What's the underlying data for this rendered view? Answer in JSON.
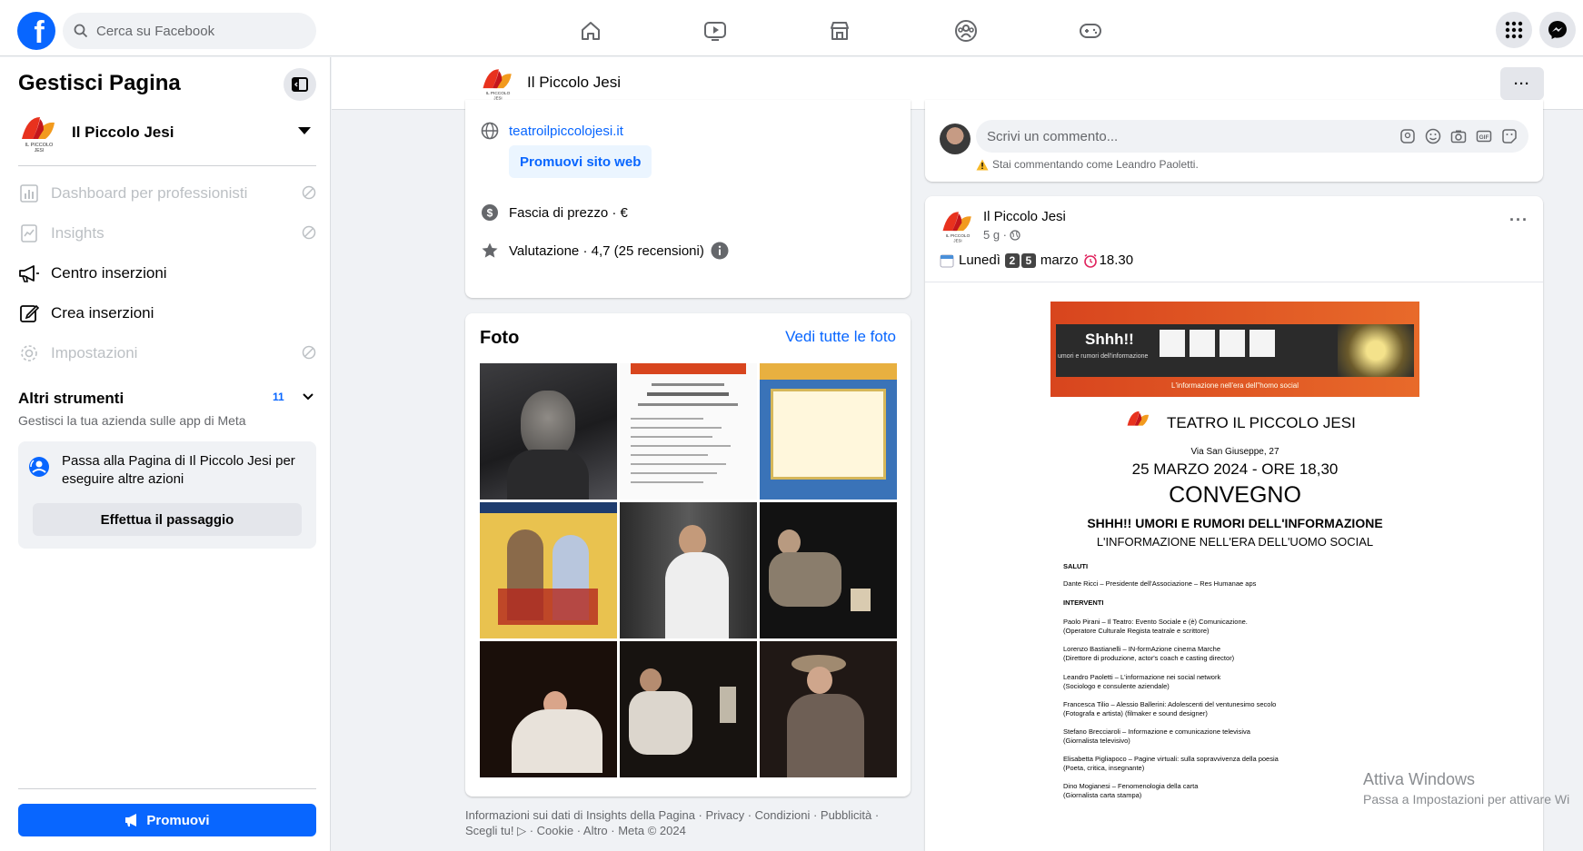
{
  "topbar": {
    "search_placeholder": "Cerca su Facebook",
    "nav_icons": [
      "home-icon",
      "video-icon",
      "marketplace-icon",
      "groups-icon",
      "gaming-icon"
    ],
    "right_icons": [
      "menu-grid-icon",
      "messenger-icon"
    ]
  },
  "sidebar": {
    "title": "Gestisci Pagina",
    "page_name": "Il Piccolo Jesi",
    "logo_text": "IL PICCOLO JESI",
    "items": [
      {
        "label": "Dashboard per professionisti",
        "disabled": true
      },
      {
        "label": "Insights",
        "disabled": true
      },
      {
        "label": "Centro inserzioni",
        "disabled": false
      },
      {
        "label": "Crea inserzioni",
        "disabled": false
      },
      {
        "label": "Impostazioni",
        "disabled": true
      }
    ],
    "tools_title": "Altri strumenti",
    "tools_badge": "11",
    "tools_subtitle": "Gestisci la tua azienda sulle app di Meta",
    "switch_text": "Passa alla Pagina di Il Piccolo Jesi per eseguire altre azioni",
    "switch_button": "Effettua il passaggio",
    "promote_button": "Promuovi"
  },
  "page_header": {
    "name": "Il Piccolo Jesi",
    "more": "···"
  },
  "info": {
    "website": "teatroilpiccolojesi.it",
    "promote_website": "Promuovi sito web",
    "price_range": "Fascia di prezzo · €",
    "rating": "Valutazione · 4,7 (25 recensioni)"
  },
  "photos": {
    "title": "Foto",
    "see_all": "Vedi tutte le foto"
  },
  "footer": {
    "text": "Informazioni sui dati di Insights della Pagina · Privacy · Condizioni · Pubblicità · Scegli tu! ▷ · Cookie · Altro · Meta © 2024"
  },
  "comment": {
    "placeholder": "Scrivi un commento...",
    "as_user": "Stai commentando come Leandro Paoletti."
  },
  "post": {
    "author": "Il Piccolo Jesi",
    "time": "5 g ·",
    "more": "···",
    "day": "Lunedì",
    "digit1": "2",
    "digit2": "5",
    "month": "marzo",
    "hour": "18.30",
    "poster": {
      "brand": "Shhh!!",
      "brand_sub": "umori e rumori dell'informazione",
      "tagline": "L'informazione nell'era dell''homo social",
      "theatre": "TEATRO IL PICCOLO JESI",
      "address": "Via San Giuseppe, 27",
      "date": "25 MARZO 2024 - ORE 18,30",
      "convegno": "CONVEGNO",
      "headline": "SHHH!! UMORI E RUMORI DELL'INFORMAZIONE",
      "subheadline": "L'INFORMAZIONE NELL'ERA DELL'UOMO SOCIAL",
      "saluti": "SALUTI",
      "saluti_1": "Dante Ricci – Presidente dell'Associazione – Res Humanae aps",
      "interventi": "INTERVENTI",
      "speakers": [
        [
          "Paolo Pirani – Il Teatro: Evento Sociale e (è) Comunicazione.",
          "(Operatore Culturale Regista teatrale e scrittore)"
        ],
        [
          "Lorenzo Bastianelli – IN-formAzione cinema Marche",
          "(Direttore di produzione, actor's coach e casting director)"
        ],
        [
          "Leandro Paoletti – L'informazione nei social network",
          "(Sociologo e consulente aziendale)"
        ],
        [
          "Francesca Tilio – Alessio Ballerini: Adolescenti del ventunesimo secolo",
          "(Fotografa e artista) (filmaker e sound designer)"
        ],
        [
          "Stefano Brecciaroli – Informazione e comunicazione televisiva",
          "(Giornalista televisivo)"
        ],
        [
          "Elisabetta Pigliapoco – Pagine virtuali: sulla sopravvivenza della poesia",
          "(Poeta, critica, insegnante)"
        ],
        [
          "Dino Mogianesi – Fenomenologia della carta",
          "(Giornalista carta stampa)"
        ]
      ]
    }
  },
  "watermark": {
    "title": "Attiva Windows",
    "subtitle": "Passa a Impostazioni per attivare Wi"
  },
  "colors": {
    "brand_blue": "#0866ff",
    "logo_red": "#e8321e",
    "logo_orange": "#f29a1e"
  }
}
